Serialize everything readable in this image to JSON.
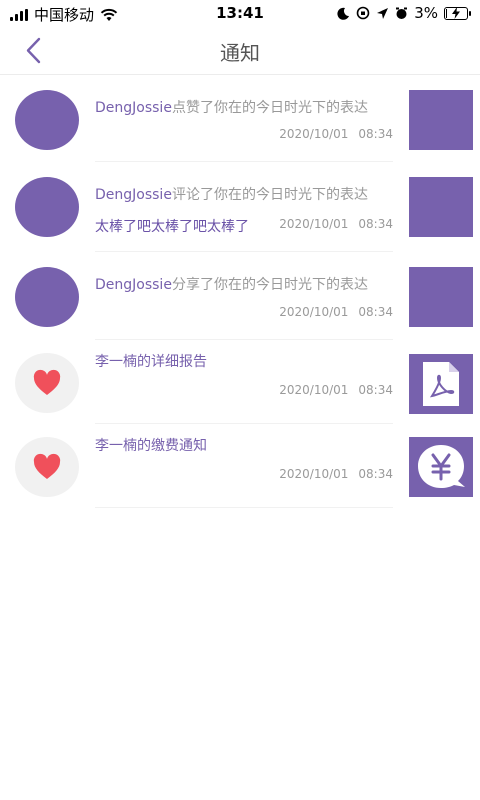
{
  "status": {
    "carrier": "中国移动",
    "time": "13:41",
    "battery": "3%",
    "battery_level": 0.03
  },
  "nav": {
    "title": "通知"
  },
  "colors": {
    "accent": "#7761ad",
    "heart": "#f0505b"
  },
  "notifications": [
    {
      "user": "DengJossie",
      "action": "点赞了你在的今日时光下的表达",
      "reply": "",
      "date": "2020/10/01",
      "time": "08:34",
      "avatar": "purple-circle",
      "thumb": "purple-square"
    },
    {
      "user": "DengJossie",
      "action": "评论了你在的今日时光下的表达",
      "reply": "太棒了吧太棒了吧太棒了",
      "date": "2020/10/01",
      "time": "08:34",
      "avatar": "purple-circle",
      "thumb": "purple-square"
    },
    {
      "user": "DengJossie",
      "action": "分享了你在的今日时光下的表达",
      "reply": "",
      "date": "2020/10/01",
      "time": "08:34",
      "avatar": "purple-circle",
      "thumb": "purple-square"
    },
    {
      "user": "李一楠的详细报告",
      "action": "",
      "reply": "",
      "date": "2020/10/01",
      "time": "08:34",
      "avatar": "heart-icon",
      "thumb": "pdf-icon"
    },
    {
      "user": "李一楠的缴费通知",
      "action": "",
      "reply": "",
      "date": "2020/10/01",
      "time": "08:34",
      "avatar": "heart-icon",
      "thumb": "yen-icon"
    }
  ]
}
